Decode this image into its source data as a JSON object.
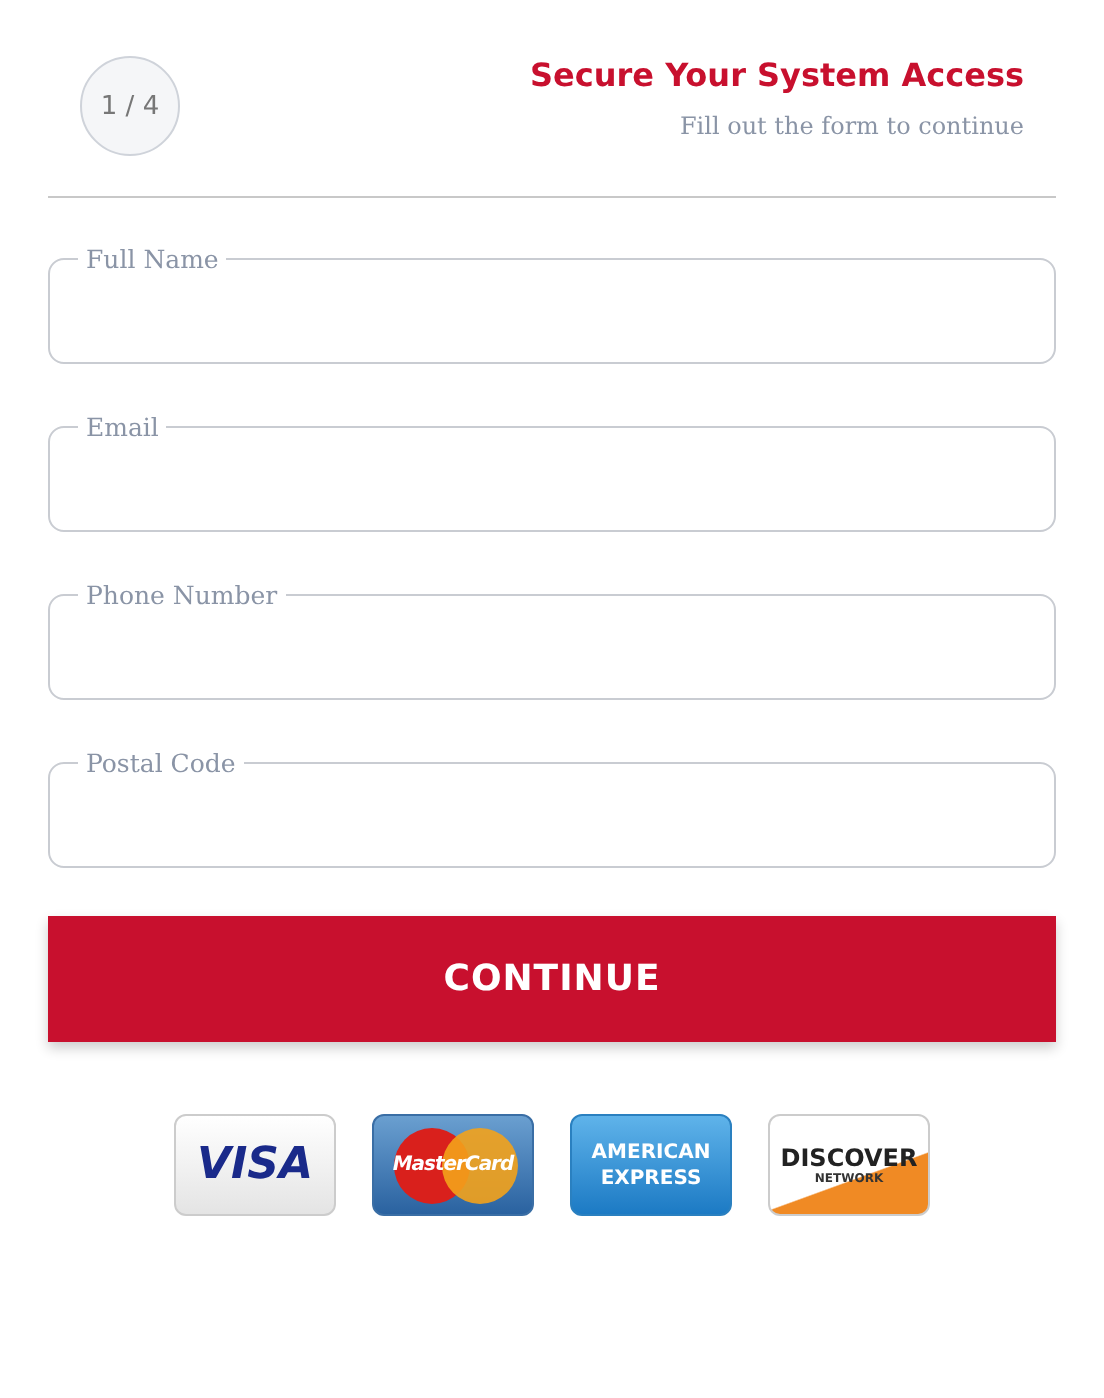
{
  "step": {
    "label": "1 / 4"
  },
  "header": {
    "title": "Secure Your System Access",
    "subtitle": "Fill out the form to continue"
  },
  "fields": [
    {
      "label": "Full Name"
    },
    {
      "label": "Email"
    },
    {
      "label": "Phone Number"
    },
    {
      "label": "Postal Code"
    }
  ],
  "button": {
    "label": "CONTINUE"
  },
  "cards": [
    {
      "kind": "visa",
      "lines": [
        "VISA"
      ]
    },
    {
      "kind": "mastercard",
      "lines": [
        "MasterCard"
      ]
    },
    {
      "kind": "amex",
      "lines": [
        "AMERICAN",
        "EXPRESS"
      ]
    },
    {
      "kind": "discover",
      "lines": [
        "DISCOVER",
        "NETWORK"
      ]
    }
  ]
}
